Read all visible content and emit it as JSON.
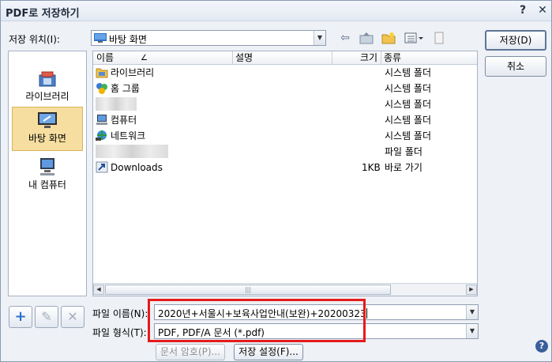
{
  "window": {
    "title": "PDF로 저장하기",
    "help_glyph": "?",
    "close_glyph": "✕"
  },
  "location": {
    "label": "저장 위치(I):",
    "value": "바탕 화면"
  },
  "places": [
    {
      "label": "라이브러리",
      "icon": "library-icon",
      "selected": false
    },
    {
      "label": "바탕 화면",
      "icon": "desktop-icon",
      "selected": true
    },
    {
      "label": "내 컴퓨터",
      "icon": "computer-icon",
      "selected": false
    }
  ],
  "columns": {
    "name": "이름",
    "sort_indicator": "∠",
    "description": "설명",
    "size": "크기",
    "type": "종류"
  },
  "files": [
    {
      "name": "라이브러리",
      "size": "",
      "type": "시스템 폴더",
      "icon": "library-folder-icon",
      "blurred": false
    },
    {
      "name": "홈 그룹",
      "size": "",
      "type": "시스템 폴더",
      "icon": "homegroup-icon",
      "blurred": false
    },
    {
      "name": "",
      "size": "",
      "type": "시스템 폴더",
      "icon": "user-folder-icon",
      "blurred": true
    },
    {
      "name": "컴퓨터",
      "size": "",
      "type": "시스템 폴더",
      "icon": "computer-icon",
      "blurred": false
    },
    {
      "name": "네트워크",
      "size": "",
      "type": "시스템 폴더",
      "icon": "network-icon",
      "blurred": false
    },
    {
      "name": "",
      "size": "",
      "type": "파일 폴더",
      "icon": "folder-icon",
      "blurred": true
    },
    {
      "name": "Downloads",
      "size": "1KB",
      "type": "바로 가기",
      "icon": "shortcut-icon",
      "blurred": false
    }
  ],
  "buttons": {
    "save": "저장(D)",
    "cancel": "취소",
    "password": "문서 암호(P)...",
    "settings": "저장 설정(F)..."
  },
  "filename": {
    "label": "파일 이름(N):",
    "value": "2020년+서울시+보육사업안내(보완)+20200323"
  },
  "filetype": {
    "label": "파일 형식(T):",
    "value": "PDF, PDF/A 문서 (*.pdf)"
  },
  "tools": {
    "add": "+",
    "edit": "✎",
    "delete": "✕"
  },
  "colors": {
    "highlight": "#e41b1b",
    "selected_place": "#f6dea0"
  }
}
